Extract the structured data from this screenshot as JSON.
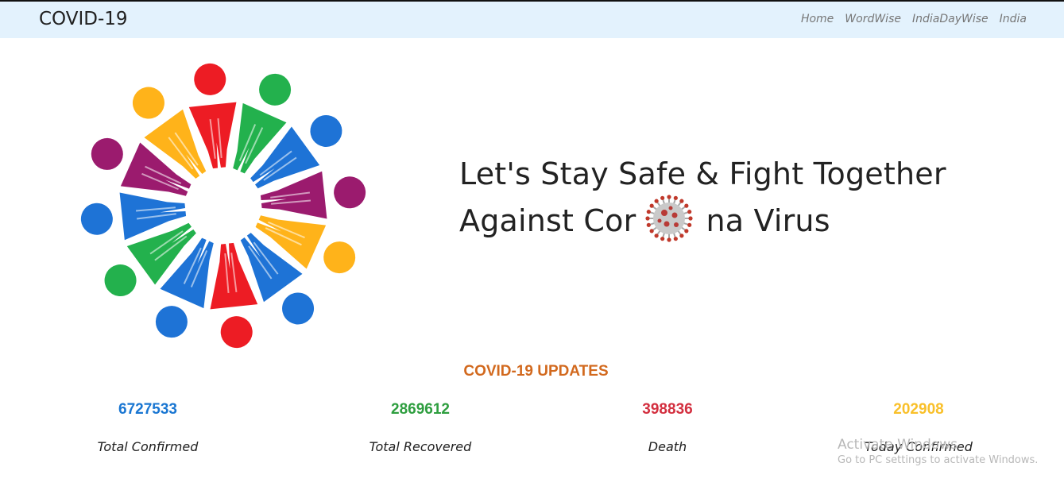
{
  "navbar": {
    "brand": "COVID-19",
    "links": [
      "Home",
      "WordWise",
      "IndiaDayWise",
      "India"
    ]
  },
  "hero": {
    "title_part1": "Let's Stay Safe & Fight Together Against Cor",
    "title_part2": "na Virus",
    "people_colors": [
      "#ed1c24",
      "#23b14d",
      "#1e73d6",
      "#9b1b6e",
      "#ffb31a",
      "#1e73d6",
      "#ed1c24",
      "#1e73d6",
      "#23b14d",
      "#1e73d6",
      "#9b1b6e",
      "#ffb31a"
    ]
  },
  "updates": {
    "heading": "COVID-19 UPDATES",
    "stats": [
      {
        "value": "6727533",
        "label": "Total Confirmed",
        "color": "#1976d2"
      },
      {
        "value": "2869612",
        "label": "Total Recovered",
        "color": "#2e9e3f"
      },
      {
        "value": "398836",
        "label": "Death",
        "color": "#d32f3f"
      },
      {
        "value": "202908",
        "label": "Today Confirmed",
        "color": "#f9c02a"
      }
    ]
  },
  "watermark": {
    "title": "Activate Windows",
    "subtitle": "Go to PC settings to activate Windows."
  }
}
